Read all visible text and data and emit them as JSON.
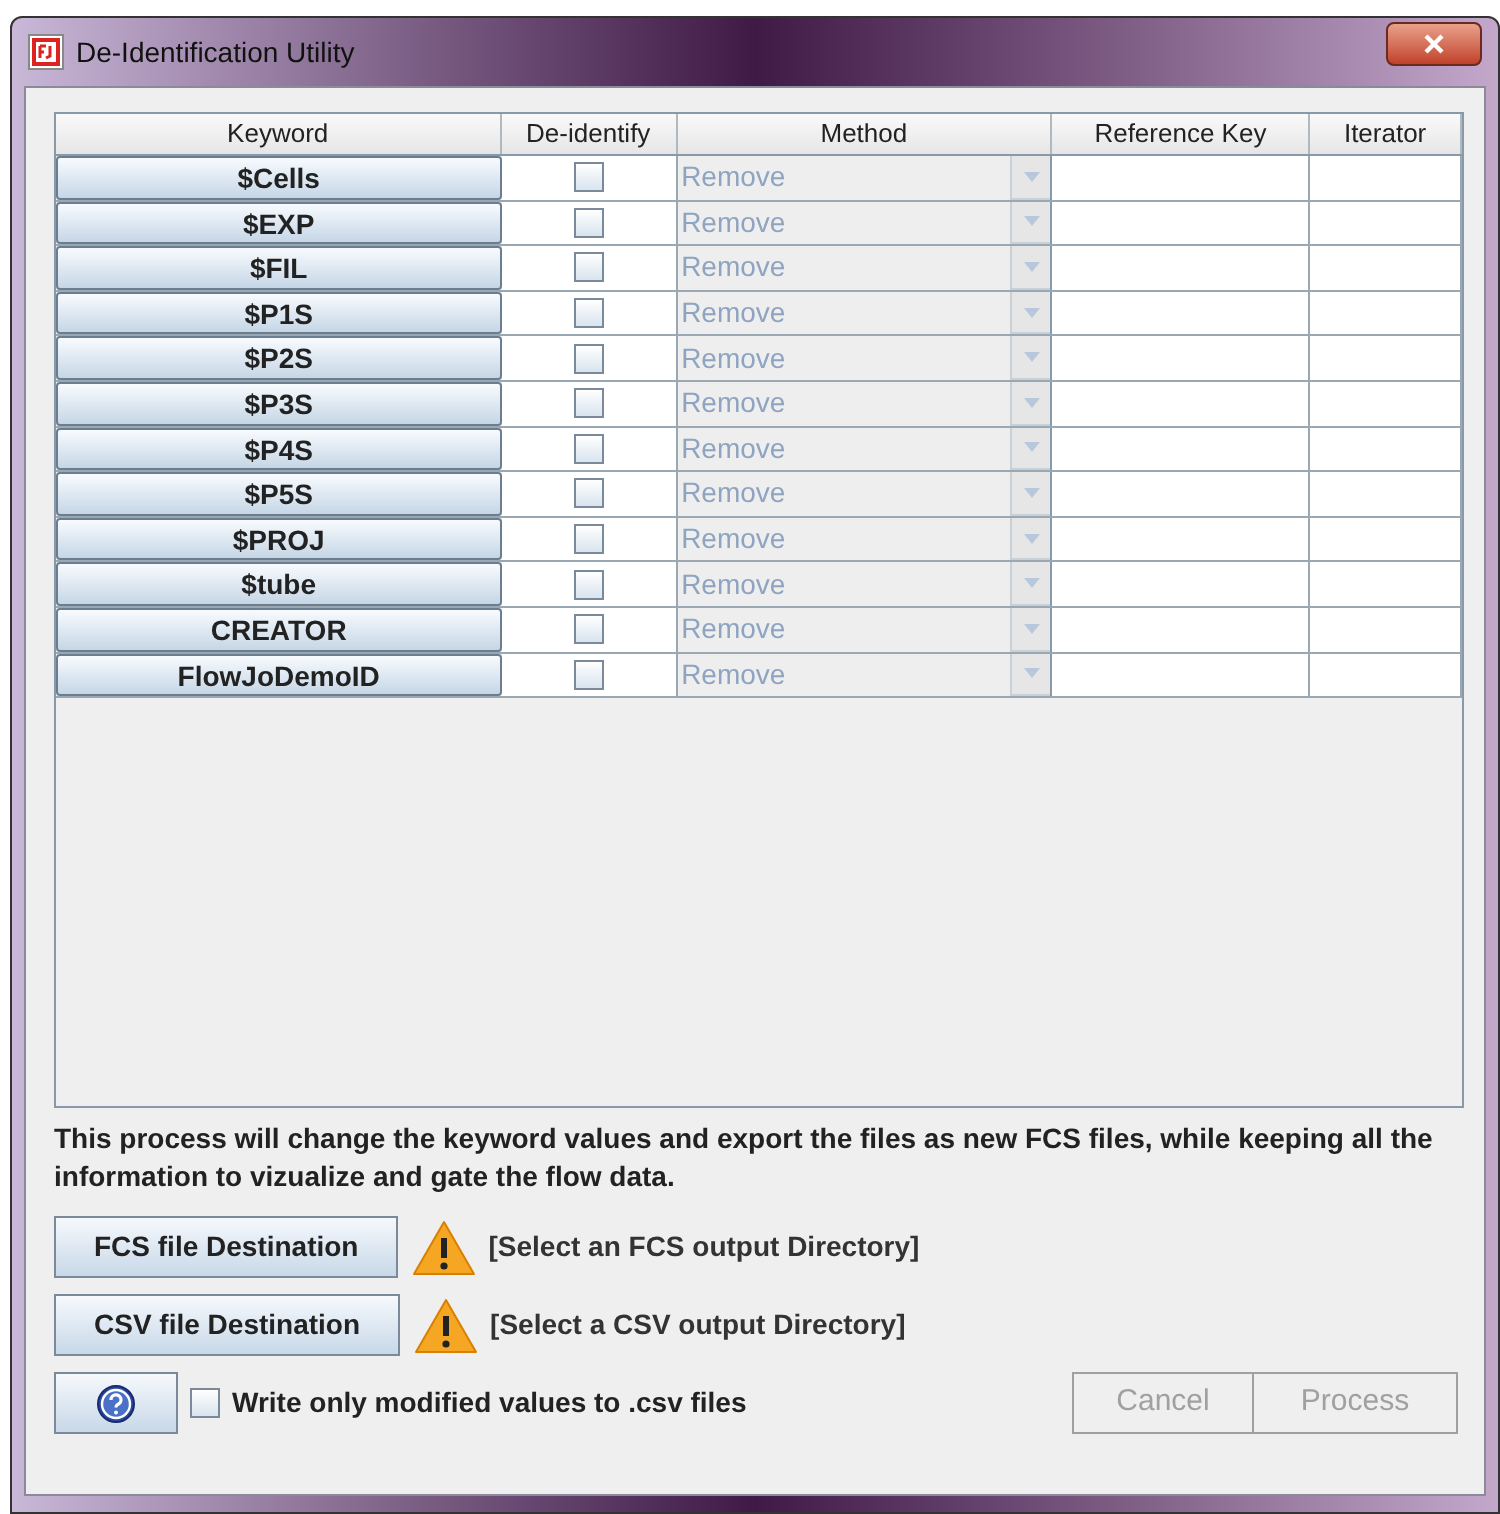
{
  "window": {
    "title": "De-Identification Utility"
  },
  "table": {
    "columns": [
      "Keyword",
      "De-identify",
      "Method",
      "Reference Key",
      "Iterator"
    ],
    "rows": [
      {
        "keyword": "$Cells",
        "deidentify": false,
        "method": "Remove",
        "method_disabled": true
      },
      {
        "keyword": "$EXP",
        "deidentify": false,
        "method": "Remove",
        "method_disabled": true
      },
      {
        "keyword": "$FIL",
        "deidentify": false,
        "method": "Remove",
        "method_disabled": true
      },
      {
        "keyword": "$P1S",
        "deidentify": false,
        "method": "Remove",
        "method_disabled": true
      },
      {
        "keyword": "$P2S",
        "deidentify": false,
        "method": "Remove",
        "method_disabled": true
      },
      {
        "keyword": "$P3S",
        "deidentify": false,
        "method": "Remove",
        "method_disabled": true
      },
      {
        "keyword": "$P4S",
        "deidentify": false,
        "method": "Remove",
        "method_disabled": true
      },
      {
        "keyword": "$P5S",
        "deidentify": false,
        "method": "Remove",
        "method_disabled": true
      },
      {
        "keyword": "$PROJ",
        "deidentify": false,
        "method": "Remove",
        "method_disabled": true
      },
      {
        "keyword": "$tube",
        "deidentify": false,
        "method": "Remove",
        "method_disabled": true
      },
      {
        "keyword": "CREATOR",
        "deidentify": false,
        "method": "Remove",
        "method_disabled": true
      },
      {
        "keyword": "FlowJoDemoID",
        "deidentify": false,
        "method": "Remove",
        "method_disabled": true
      }
    ]
  },
  "description": "This process will change the keyword values and export the files as new FCS files, while keeping all the information to vizualize and gate the flow data.",
  "destinations": [
    {
      "button": "FCS file Destination",
      "status": "[Select an FCS output Directory]"
    },
    {
      "button": "CSV file Destination",
      "status": "[Select a CSV output Directory]"
    }
  ],
  "write_modified_only": {
    "label": "Write only modified values to .csv files",
    "checked": false
  },
  "buttons": [
    {
      "label": "Cancel",
      "disabled": true
    },
    {
      "label": "Process",
      "disabled": true
    }
  ]
}
